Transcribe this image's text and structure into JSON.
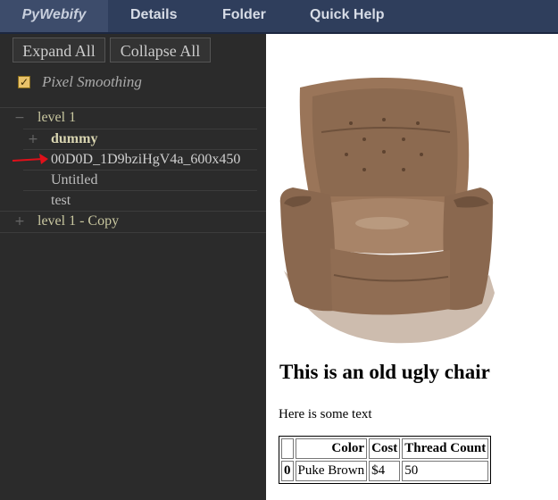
{
  "nav": {
    "brand": "PyWebify",
    "items": [
      {
        "label": "Details"
      },
      {
        "label": "Folder"
      },
      {
        "label": "Quick Help"
      }
    ]
  },
  "sidebar": {
    "expand_all": "Expand All",
    "collapse_all": "Collapse All",
    "pixel_smoothing": {
      "label": "Pixel Smoothing",
      "checked": true,
      "check_glyph": "✓"
    },
    "tree": [
      {
        "toggle": "−",
        "label": "level 1"
      },
      {
        "toggle": "+",
        "label": "dummy"
      },
      {
        "toggle": "",
        "label": "00D0D_1D9bziHgV4a_600x450"
      },
      {
        "toggle": "",
        "label": "Untitled"
      },
      {
        "toggle": "",
        "label": "test"
      },
      {
        "toggle": "+",
        "label": "level 1 - Copy"
      }
    ],
    "selected_marker_color": "#e0101a"
  },
  "content": {
    "image_icon": "armchair-photo",
    "heading": "This is an old ugly chair",
    "paragraph": "Here is some text",
    "table": {
      "columns": [
        "",
        "Color",
        "Cost",
        "Thread Count"
      ],
      "rows": [
        {
          "index": "0",
          "cells": [
            "Puke Brown",
            "$4",
            "50"
          ]
        }
      ]
    }
  }
}
